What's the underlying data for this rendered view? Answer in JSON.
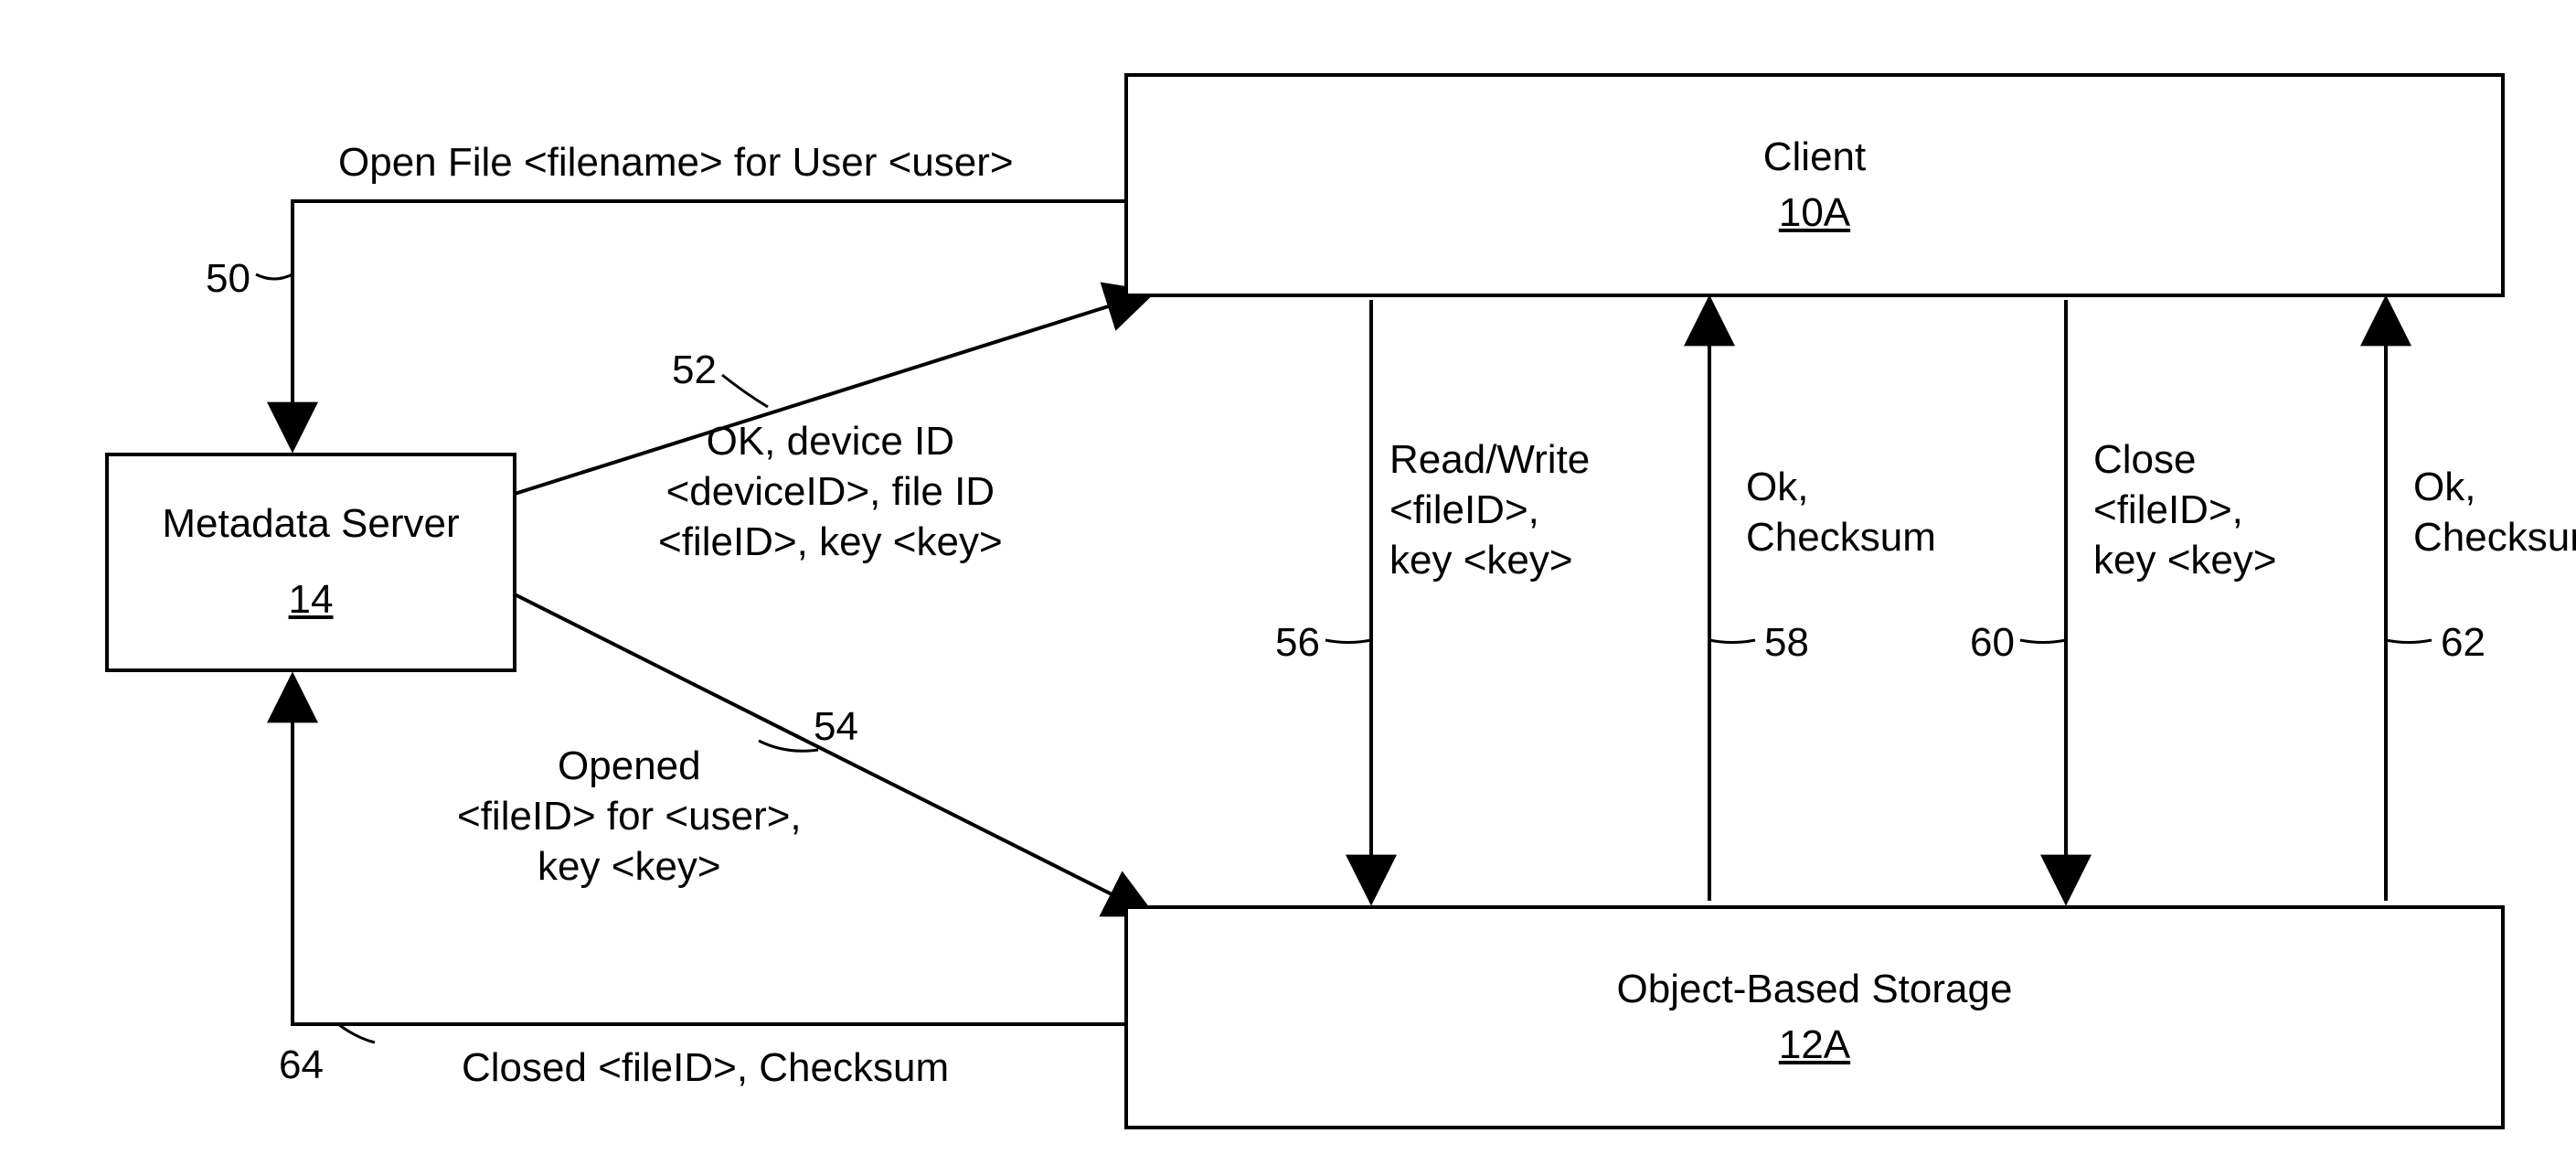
{
  "boxes": {
    "client": {
      "title": "Client",
      "ref": "10A"
    },
    "metadata": {
      "title": "Metadata Server",
      "ref": "14"
    },
    "storage": {
      "title": "Object-Based Storage",
      "ref": "12A"
    }
  },
  "labels": {
    "l50": "Open File <filename> for User <user>",
    "l52": "OK, device ID\n<deviceID>, file ID\n<fileID>, key <key>",
    "l54": "Opened\n<fileID> for <user>,\nkey <key>",
    "l56": "Read/Write\n<fileID>,\nkey <key>",
    "l58": "Ok,\nChecksum",
    "l60": "Close\n<fileID>,\nkey <key>",
    "l62": "Ok,\nChecksum",
    "l64": "Closed <fileID>, Checksum"
  },
  "nums": {
    "n50": "50",
    "n52": "52",
    "n54": "54",
    "n56": "56",
    "n58": "58",
    "n60": "60",
    "n62": "62",
    "n64": "64"
  }
}
